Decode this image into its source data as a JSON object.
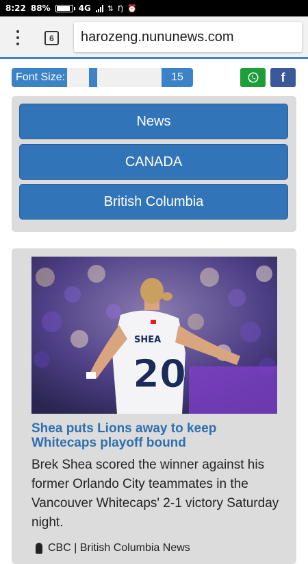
{
  "status_bar": {
    "time": "8:22",
    "battery_percent": "88%",
    "battery_level": 0.88,
    "network": "4G"
  },
  "browser": {
    "tab_count": "6",
    "url": "harozeng.nununews.com"
  },
  "font_control": {
    "label": "Font Size:",
    "value": "15"
  },
  "share": {
    "whatsapp_icon": "whatsapp-icon",
    "facebook_glyph": "f"
  },
  "categories": [
    {
      "label": "News"
    },
    {
      "label": "CANADA"
    },
    {
      "label": "British Columbia"
    }
  ],
  "article": {
    "jersey_name": "SHEA",
    "jersey_number": "20",
    "title": "Shea puts Lions away to keep Whitecaps playoff bound",
    "summary": "Brek Shea scored the winner against his former Orlando City teammates in the Vancouver Whitecaps' 2-1 victory Saturday night.",
    "source": "CBC | British Columbia News"
  },
  "colors": {
    "accent": "#3b82c7",
    "category_button": "#3174b8",
    "title_link": "#2f6fb0",
    "whatsapp": "#1e9e3a",
    "facebook": "#3b5998"
  }
}
